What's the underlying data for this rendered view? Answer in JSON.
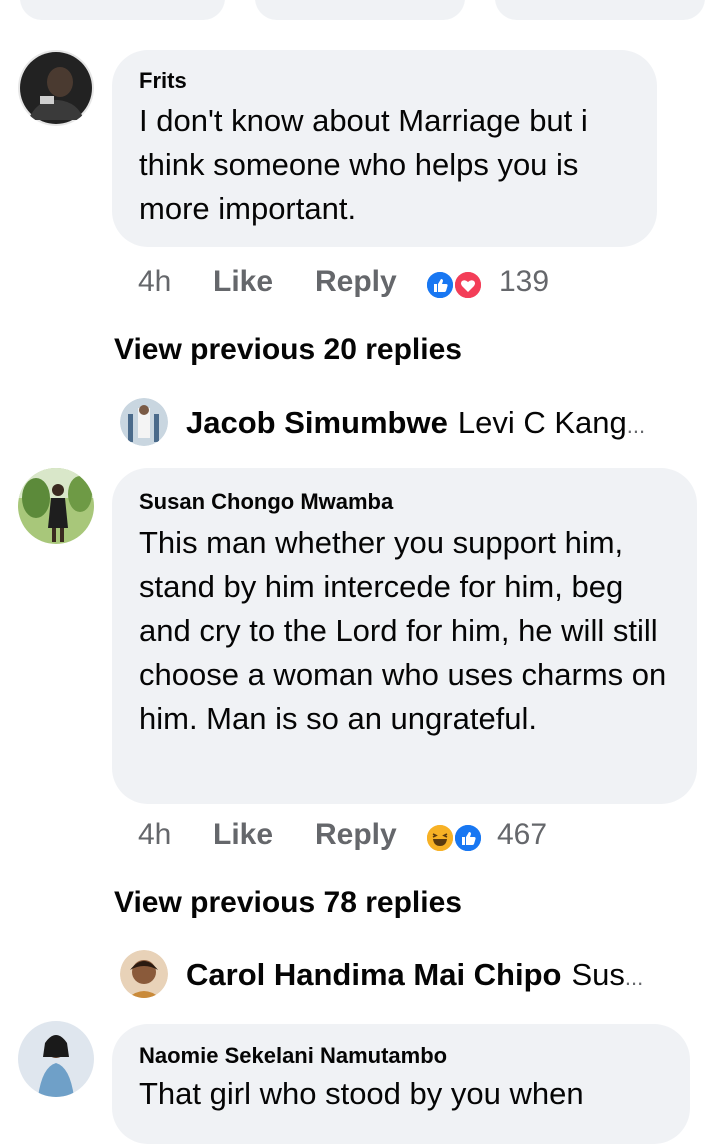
{
  "comments": [
    {
      "author": "Frits",
      "text": "I don't know about Marriage but i think someone who helps you is more important.",
      "time": "4h",
      "like_label": "Like",
      "reply_label": "Reply",
      "reaction_count": "139",
      "reactions": [
        "like-icon",
        "love-icon"
      ],
      "view_previous": "View previous 20 replies",
      "latest_reply": {
        "name": "Jacob Simumbwe",
        "text": "Levi C Kang",
        "ellipsis": "..."
      }
    },
    {
      "author": "Susan Chongo Mwamba",
      "text": "This man whether you support him, stand by him intercede for him, beg and cry to the Lord for him, he will still choose a woman who uses charms on him.  Man is so an ungrateful.",
      "time": "4h",
      "like_label": "Like",
      "reply_label": "Reply",
      "reaction_count": "467",
      "reactions": [
        "haha-icon",
        "like-icon"
      ],
      "view_previous": "View previous 78 replies",
      "latest_reply": {
        "name": "Carol Handima Mai Chipo",
        "text": "Sus",
        "ellipsis": "..."
      }
    },
    {
      "author": "Naomie Sekelani Namutambo",
      "text": "That girl who stood by you when"
    }
  ],
  "colors": {
    "bubble": "#f0f2f5",
    "meta": "#65676b",
    "like_blue": "#1877f2",
    "love_red": "#f33e58",
    "haha_yellow": "#f7b125"
  }
}
